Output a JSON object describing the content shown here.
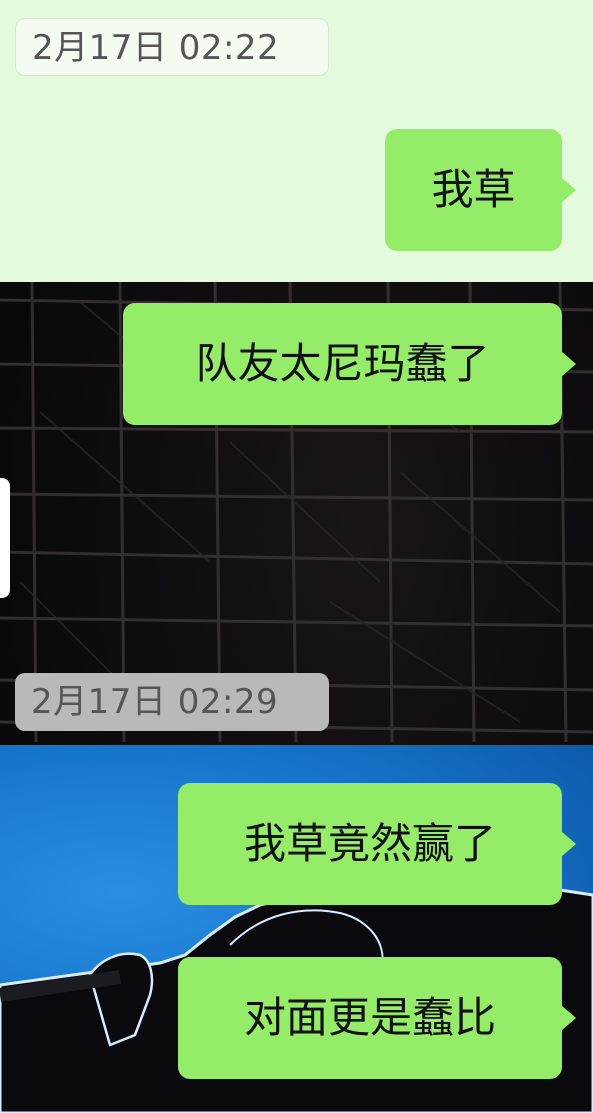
{
  "chat": {
    "messages": [
      {
        "type": "timestamp",
        "text": "2月17日 02:22"
      },
      {
        "type": "outgoing",
        "text": "我草"
      },
      {
        "type": "outgoing",
        "text": "队友太尼玛蠢了"
      },
      {
        "type": "timestamp",
        "text": "2月17日 02:29"
      },
      {
        "type": "outgoing",
        "text": "我草竟然赢了"
      },
      {
        "type": "outgoing",
        "text": "对面更是蠢比"
      }
    ]
  },
  "colors": {
    "outgoing_bubble": "#95ec69",
    "top_background": "#e3fbdc",
    "stage_background": "#0b0a0c",
    "blue_background": "#1879cf",
    "timestamp_text": "#555555"
  },
  "background_image": {
    "description_icon": "concert-stage-image"
  }
}
